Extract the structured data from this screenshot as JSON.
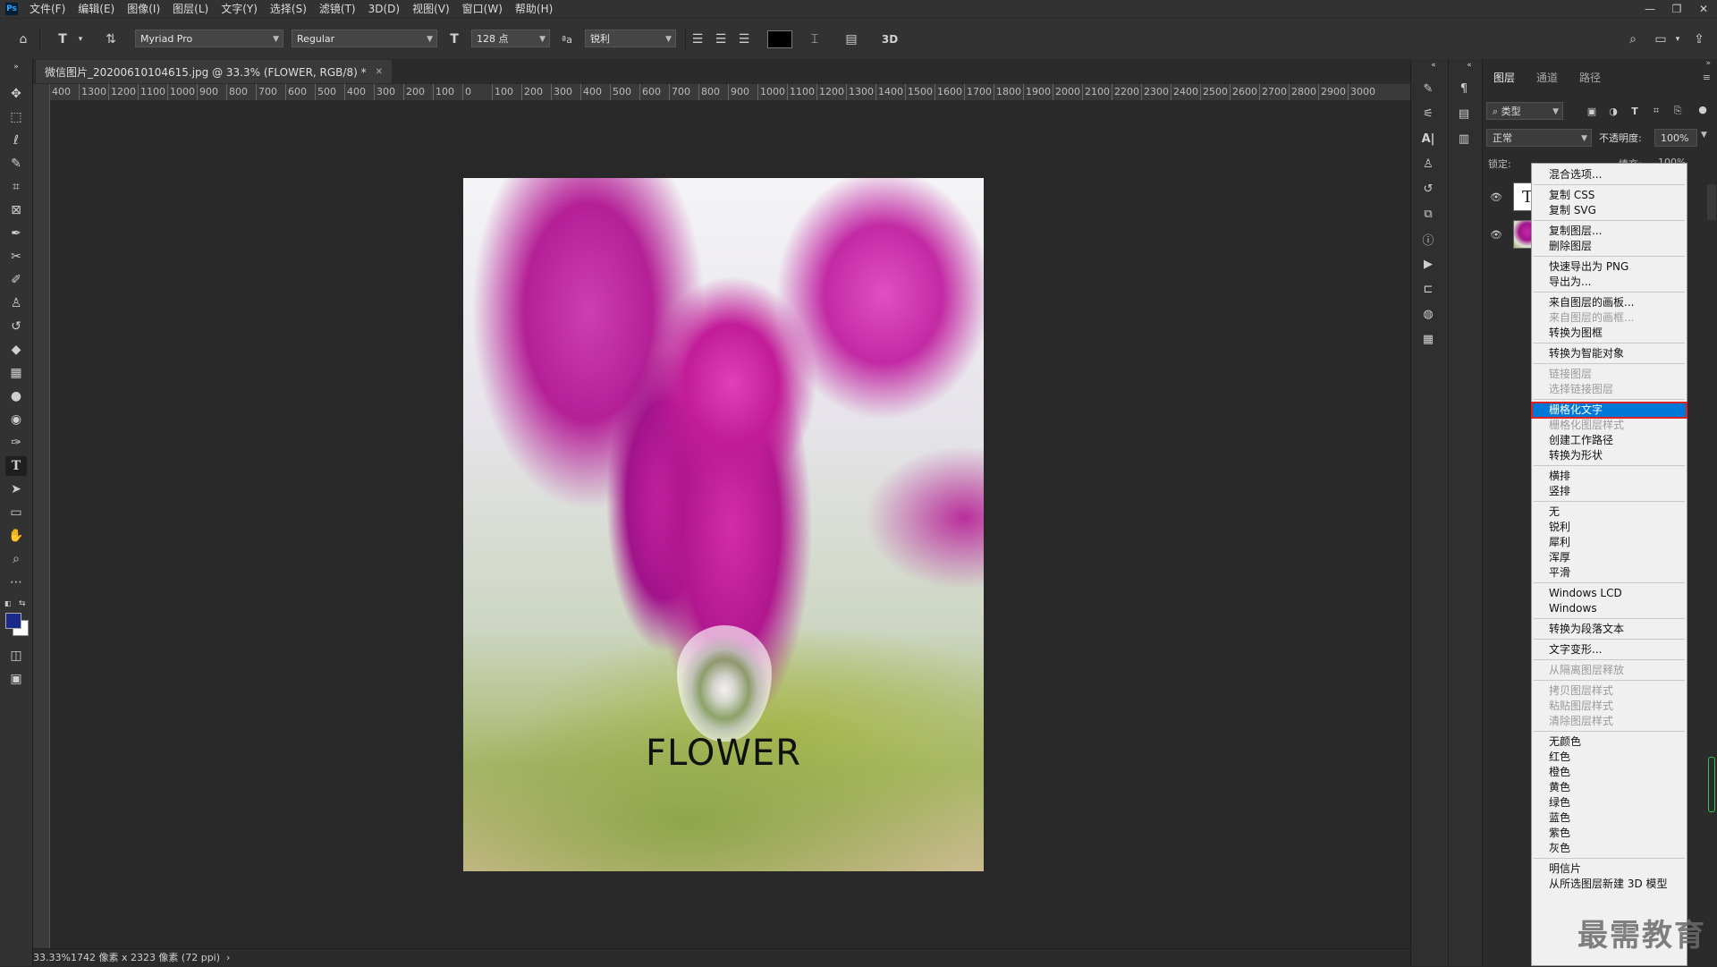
{
  "menubar": {
    "logo": "Ps",
    "items": [
      "文件(F)",
      "编辑(E)",
      "图像(I)",
      "图层(L)",
      "文字(Y)",
      "选择(S)",
      "滤镜(T)",
      "3D(D)",
      "视图(V)",
      "窗口(W)",
      "帮助(H)"
    ],
    "window_controls": [
      "—",
      "❐",
      "✕"
    ]
  },
  "options": {
    "font_family": "Myriad Pro",
    "font_style": "Regular",
    "font_size": "128 点",
    "aa_label": "ªa",
    "antialias": "锐利",
    "three_d": "3D",
    "text_color": "#000000"
  },
  "document": {
    "tab_title": "微信图片_20200610104615.jpg @ 33.3% (FLOWER, RGB/8) *",
    "text_layer": "FLOWER"
  },
  "ruler": {
    "top_labels": [
      "400",
      "1300",
      "1200",
      "1100",
      "1000",
      "900",
      "800",
      "700",
      "600",
      "500",
      "400",
      "300",
      "200",
      "100",
      "0",
      "100",
      "200",
      "300",
      "400",
      "500",
      "600",
      "700",
      "800",
      "900",
      "1000",
      "1100",
      "1200",
      "1300",
      "1400",
      "1500",
      "1600",
      "1700",
      "1800",
      "1900",
      "2000",
      "2100",
      "2200",
      "2300",
      "2400",
      "2500",
      "2600",
      "2700",
      "2800",
      "2900",
      "3000"
    ]
  },
  "status": {
    "zoom": "33.33%",
    "dimensions": "1742 像素 x 2323 像素 (72 ppi)"
  },
  "layers_panel": {
    "tabs": [
      "图层",
      "通道",
      "路径"
    ],
    "filter_type": "类型",
    "blend_mode": "正常",
    "opacity_label": "不透明度:",
    "opacity_value": "100%",
    "lock_label": "锁定:",
    "fill_label": "填充:",
    "fill_value": "100%",
    "text_thumb": "T"
  },
  "context_menu": {
    "items": [
      {
        "label": "混合选项...",
        "disabled": false
      },
      {
        "label": "复制 CSS",
        "disabled": false
      },
      {
        "label": "复制 SVG",
        "disabled": false
      },
      {
        "label": "复制图层...",
        "disabled": false
      },
      {
        "label": "删除图层",
        "disabled": false
      },
      {
        "label": "快速导出为 PNG",
        "disabled": false
      },
      {
        "label": "导出为...",
        "disabled": false
      },
      {
        "label": "来自图层的画板...",
        "disabled": false
      },
      {
        "label": "来自图层的画框...",
        "disabled": true
      },
      {
        "label": "转换为图框",
        "disabled": false
      },
      {
        "label": "转换为智能对象",
        "disabled": false
      },
      {
        "label": "链接图层",
        "disabled": true
      },
      {
        "label": "选择链接图层",
        "disabled": true
      },
      {
        "label": "栅格化文字",
        "disabled": false,
        "highlighted": true
      },
      {
        "label": "栅格化图层样式",
        "disabled": true
      },
      {
        "label": "创建工作路径",
        "disabled": false
      },
      {
        "label": "转换为形状",
        "disabled": false
      },
      {
        "label": "横排",
        "disabled": false
      },
      {
        "label": "竖排",
        "disabled": false
      },
      {
        "label": "无",
        "disabled": false
      },
      {
        "label": "锐利",
        "disabled": false
      },
      {
        "label": "犀利",
        "disabled": false
      },
      {
        "label": "浑厚",
        "disabled": false
      },
      {
        "label": "平滑",
        "disabled": false
      },
      {
        "label": "Windows LCD",
        "disabled": false
      },
      {
        "label": "Windows",
        "disabled": false
      },
      {
        "label": "转换为段落文本",
        "disabled": false
      },
      {
        "label": "文字变形...",
        "disabled": false
      },
      {
        "label": "从隔离图层释放",
        "disabled": true
      },
      {
        "label": "拷贝图层样式",
        "disabled": true
      },
      {
        "label": "粘贴图层样式",
        "disabled": true
      },
      {
        "label": "清除图层样式",
        "disabled": true
      },
      {
        "label": "无颜色",
        "disabled": false
      },
      {
        "label": "红色",
        "disabled": false
      },
      {
        "label": "橙色",
        "disabled": false
      },
      {
        "label": "黄色",
        "disabled": false
      },
      {
        "label": "绿色",
        "disabled": false
      },
      {
        "label": "蓝色",
        "disabled": false
      },
      {
        "label": "紫色",
        "disabled": false
      },
      {
        "label": "灰色",
        "disabled": false
      },
      {
        "label": "明信片",
        "disabled": false
      },
      {
        "label": "从所选图层新建 3D 模型",
        "disabled": false
      }
    ]
  },
  "watermark": "最需教育",
  "colors": {
    "foreground": "#1b2a8a",
    "background": "#ffffff",
    "menu_highlight": "#0078d7",
    "highlight_outline": "#e02020"
  }
}
